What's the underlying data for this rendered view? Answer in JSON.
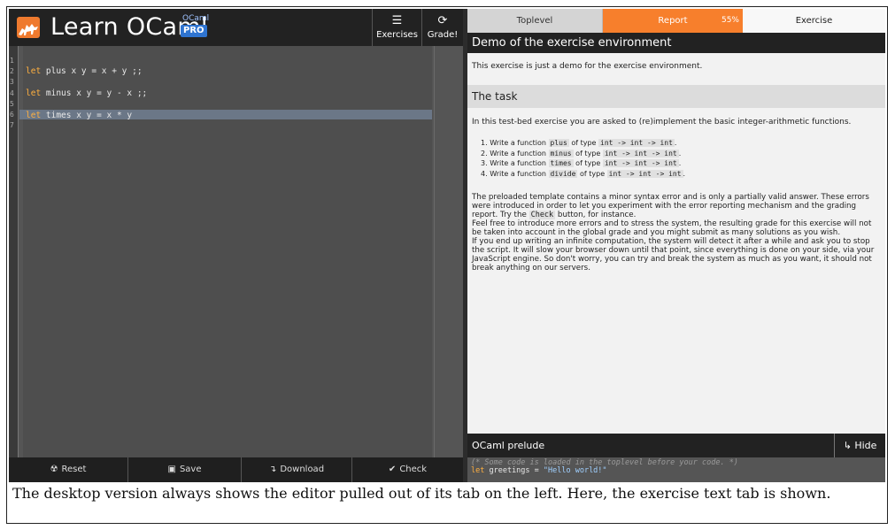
{
  "app": {
    "title": "Learn OCaml",
    "subtitle": "OCaml",
    "edition": "PRO",
    "exercises_label": "Exercises",
    "grade_label": "Grade!"
  },
  "editor": {
    "line_numbers": [
      "1",
      "2",
      "3",
      "4",
      "5",
      "6",
      "7"
    ],
    "lines": [
      {
        "kw": "let",
        "rest": " plus x y = x + y ;;"
      },
      {
        "kw": "let",
        "rest": " minus x y = y - x ;;"
      },
      {
        "kw": "let",
        "rest": " times x y = x * y"
      }
    ],
    "highlighted_line": 6
  },
  "bottom_bar": {
    "reset": "Reset",
    "save": "Save",
    "download": "Download",
    "check": "Check"
  },
  "tabs": {
    "toplevel": "Toplevel",
    "report": "Report",
    "report_percent": "55%",
    "exercise": "Exercise"
  },
  "exercise": {
    "title": "Demo of the exercise environment",
    "intro": "This exercise is just a demo for the exercise environment.",
    "task_heading": "The task",
    "task_intro": "In this test-bed exercise you are asked to (re)implement the basic integer-arithmetic functions.",
    "tasks": [
      {
        "num": "1.",
        "pre": "Write a function",
        "name": "plus",
        "mid": "of type",
        "type": "int -> int -> int"
      },
      {
        "num": "2.",
        "pre": "Write a function",
        "name": "minus",
        "mid": "of type",
        "type": "int -> int -> int"
      },
      {
        "num": "3.",
        "pre": "Write a function",
        "name": "times",
        "mid": "of type",
        "type": "int -> int -> int"
      },
      {
        "num": "4.",
        "pre": "Write a function",
        "name": "divide",
        "mid": "of type",
        "type": "int -> int -> int"
      }
    ],
    "para1_a": "The preloaded template contains a minor syntax error and is only a partially valid answer. These errors were introduced in order to let you experiment with the error reporting mechanism and the grading report. Try the ",
    "para1_code": "Check",
    "para1_b": " button, for instance.",
    "para2": "Feel free to introduce more errors and to stress the system, the resulting grade for this exercise will not be taken into account in the global grade and you might submit as many solutions as you wish.",
    "para3": "If you end up writing an infinite computation, the system will detect it after a while and ask you to stop the script. It will slow your browser down until that point, since everything is done on your side, via your JavaScript engine. So don't worry, you can try and break the system as much as you want, it should not break anything on our servers."
  },
  "prelude": {
    "title": "OCaml prelude",
    "hide_label": "Hide",
    "comment": "(* Some code is loaded in the toplevel before your code. *)",
    "code_kw": "let",
    "code_id": " greetings = ",
    "code_str": "\"Hello world!\""
  },
  "caption": "The desktop version always shows the editor pulled out of its tab on the left. Here, the exercise text tab is shown.",
  "colors": {
    "accent_orange": "#f77f2c",
    "pro_blue": "#2f74d0",
    "keyword": "#ffb040"
  }
}
